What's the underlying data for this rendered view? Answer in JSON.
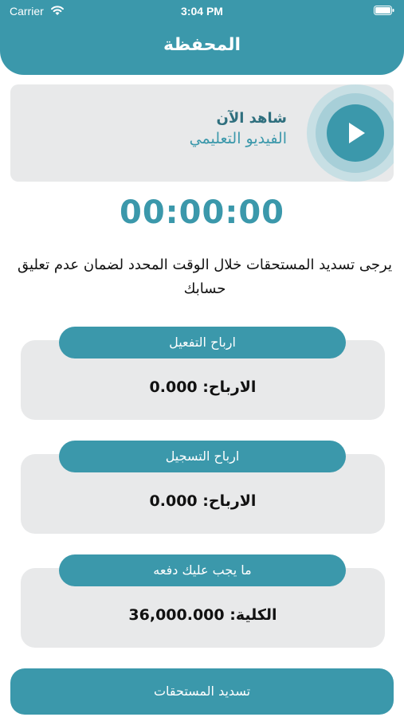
{
  "status_bar": {
    "carrier": "Carrier",
    "time": "3:04 PM"
  },
  "header": {
    "title": "المحفظة"
  },
  "video_card": {
    "title": "شاهد الآن",
    "subtitle": "الفيديو التعليمي",
    "play_icon": "play-icon"
  },
  "timer": {
    "value": "00:00:00"
  },
  "notice": {
    "text": "يرجى تسديد المستحقات خلال الوقت المحدد لضمان عدم تعليق حسابك"
  },
  "cards": [
    {
      "label": "ارباح التفعيل",
      "value_label": "الارباح:",
      "value": "0.000"
    },
    {
      "label": "ارباح التسجيل",
      "value_label": "الارباح:",
      "value": "0.000"
    },
    {
      "label": "ما يجب عليك دفعه",
      "value_label": "الكلية:",
      "value": "36,000.000"
    }
  ],
  "pay_button": {
    "label": "تسديد المستحقات"
  },
  "colors": {
    "primary": "#3b98ab",
    "card_bg": "#e8e9ea",
    "dark_teal": "#2f6f7e"
  }
}
